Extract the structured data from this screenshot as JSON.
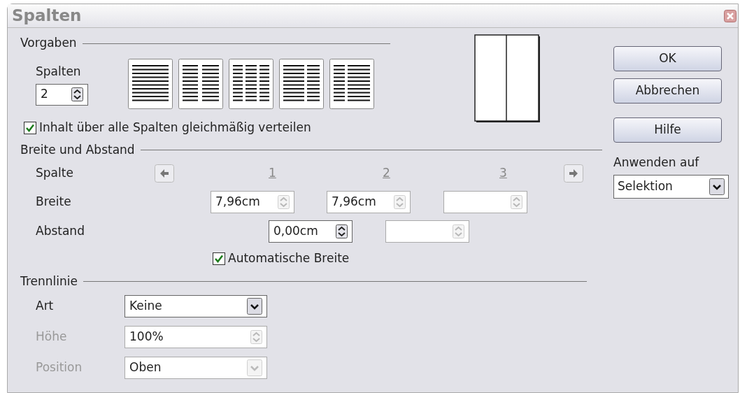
{
  "window": {
    "title": "Spalten"
  },
  "presets": {
    "heading": "Vorgaben",
    "columns_label": "Spalten",
    "columns_value": "2",
    "layouts": [
      {
        "kind": "single"
      },
      {
        "kind": "double"
      },
      {
        "kind": "triple"
      },
      {
        "kind": "wide_left"
      },
      {
        "kind": "wide_right"
      }
    ]
  },
  "distribute": {
    "label": "Inhalt über alle Spalten gleichmäßig verteilen",
    "checked": true
  },
  "width_spacing": {
    "heading": "Breite und Abstand",
    "column_label": "Spalte",
    "column_numbers": [
      "1",
      "2",
      "3"
    ],
    "width_label": "Breite",
    "widths": [
      {
        "value": "7,96cm",
        "disabled": true
      },
      {
        "value": "7,96cm",
        "disabled": true
      },
      {
        "disabled": true
      }
    ],
    "spacing_label": "Abstand",
    "spacings": [
      {
        "value": "0,00cm",
        "disabled": false
      },
      {
        "disabled": true
      }
    ],
    "auto_width": {
      "label": "Automatische Breite",
      "checked": true
    }
  },
  "separator": {
    "heading": "Trennlinie",
    "fields": [
      {
        "label": "Art",
        "value": "Keine",
        "kind": "dropdown",
        "disabled": false
      },
      {
        "label": "Höhe",
        "value": "100%",
        "kind": "spin",
        "disabled": true
      },
      {
        "label": "Position",
        "value": "Oben",
        "kind": "dropdown",
        "disabled": true
      }
    ]
  },
  "buttons": [
    {
      "label": "OK"
    },
    {
      "label": "Abbrechen"
    },
    {
      "label": "Hilfe"
    }
  ],
  "apply_to": {
    "label": "Anwenden auf",
    "value": "Selektion"
  }
}
